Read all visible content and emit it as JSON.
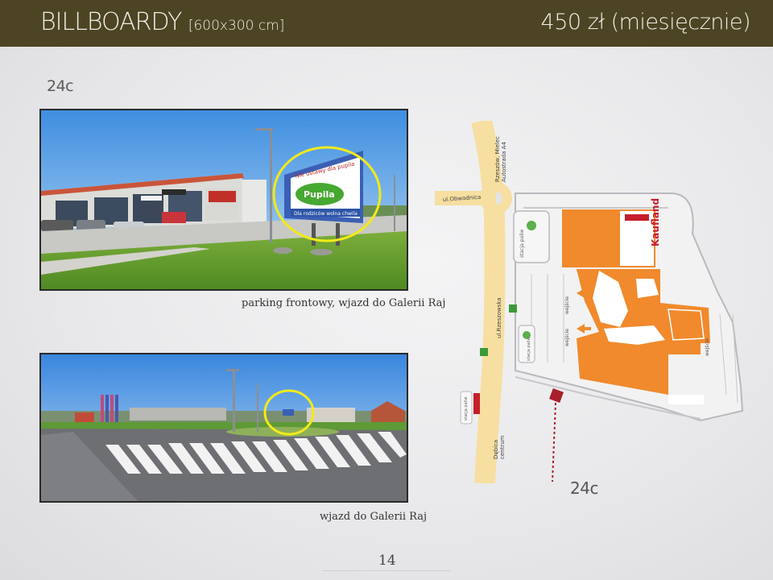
{
  "header": {
    "title": "BILLBOARDY",
    "size_note": "[600x300 cm]",
    "price": "450 zł (miesięcznie)"
  },
  "location_code": "24c",
  "photos": [
    {
      "caption": "parking frontowy, wjazd do Galerii Raj"
    },
    {
      "caption": "wjazd do Galerii Raj"
    }
  ],
  "billboard_texts": {
    "headline": "Nie ustawy dla pupila",
    "brand": "Pupila",
    "tagline": "Dla rodziców wolna chwila"
  },
  "map": {
    "streets": {
      "obwodnica": "ul.Obwodnica",
      "krakowska": "ul.Rzeszowska",
      "direction_top_1": "Rzeszów, Mielec",
      "direction_top_2": "Autostrada A4",
      "direction_bottom_1": "Dębica",
      "direction_bottom_2": "centrum"
    },
    "store": "Kaufland",
    "fuel_1": "stacja paliw",
    "fuel_2": "stacja paliw",
    "fuel_3": "stacja paliw",
    "entrance_1": "wejście",
    "entrance_2": "wejście",
    "entrance_3": "wejście",
    "billboard_label": "24c"
  },
  "page_number": "14",
  "colors": {
    "header_bg": "#4c4423",
    "mall_orange": "#f08a2c",
    "road_yellow": "#f6dfa0",
    "marker_red": "#a8202a",
    "highlight_yellow": "#f2ea1a"
  }
}
